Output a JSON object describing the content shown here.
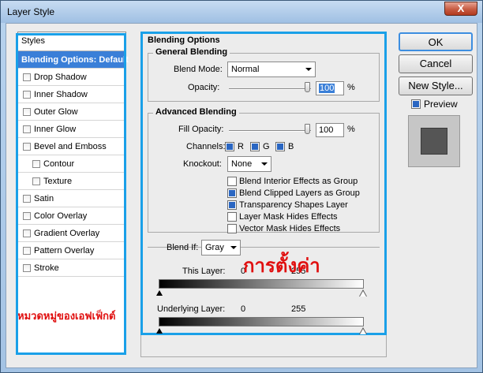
{
  "window": {
    "title": "Layer Style",
    "close_label": "X"
  },
  "styles": {
    "header": "Styles",
    "items": [
      {
        "label": "Blending Options: Default"
      },
      {
        "label": "Drop Shadow"
      },
      {
        "label": "Inner Shadow"
      },
      {
        "label": "Outer Glow"
      },
      {
        "label": "Inner Glow"
      },
      {
        "label": "Bevel and Emboss"
      },
      {
        "label": "Contour"
      },
      {
        "label": "Texture"
      },
      {
        "label": "Satin"
      },
      {
        "label": "Color Overlay"
      },
      {
        "label": "Gradient Overlay"
      },
      {
        "label": "Pattern Overlay"
      },
      {
        "label": "Stroke"
      }
    ],
    "annotation": "หมวดหมู่ของเอฟเฟ็กต์"
  },
  "blending": {
    "title": "Blending Options",
    "general": {
      "title": "General Blending",
      "blend_mode_label": "Blend Mode:",
      "blend_mode_value": "Normal",
      "opacity_label": "Opacity:",
      "opacity_value": "100",
      "unit": "%"
    },
    "advanced": {
      "title": "Advanced Blending",
      "fill_opacity_label": "Fill Opacity:",
      "fill_opacity_value": "100",
      "unit": "%",
      "channels_label": "Channels:",
      "channels": [
        "R",
        "G",
        "B"
      ],
      "knockout_label": "Knockout:",
      "knockout_value": "None",
      "options": [
        {
          "label": "Blend Interior Effects as Group",
          "checked": false
        },
        {
          "label": "Blend Clipped Layers as Group",
          "checked": true
        },
        {
          "label": "Transparency Shapes Layer",
          "checked": true
        },
        {
          "label": "Layer Mask Hides Effects",
          "checked": false
        },
        {
          "label": "Vector Mask Hides Effects",
          "checked": false
        }
      ]
    },
    "blend_if": {
      "label": "Blend If:",
      "value": "Gray",
      "this_layer_label": "This Layer:",
      "this_layer_min": "0",
      "this_layer_max": "255",
      "underlying_label": "Underlying Layer:",
      "underlying_min": "0",
      "underlying_max": "255"
    },
    "annotation": "การตั้งค่า"
  },
  "buttons": {
    "ok": "OK",
    "cancel": "Cancel",
    "new_style": "New Style..."
  },
  "preview": {
    "label": "Preview",
    "checked": true
  }
}
